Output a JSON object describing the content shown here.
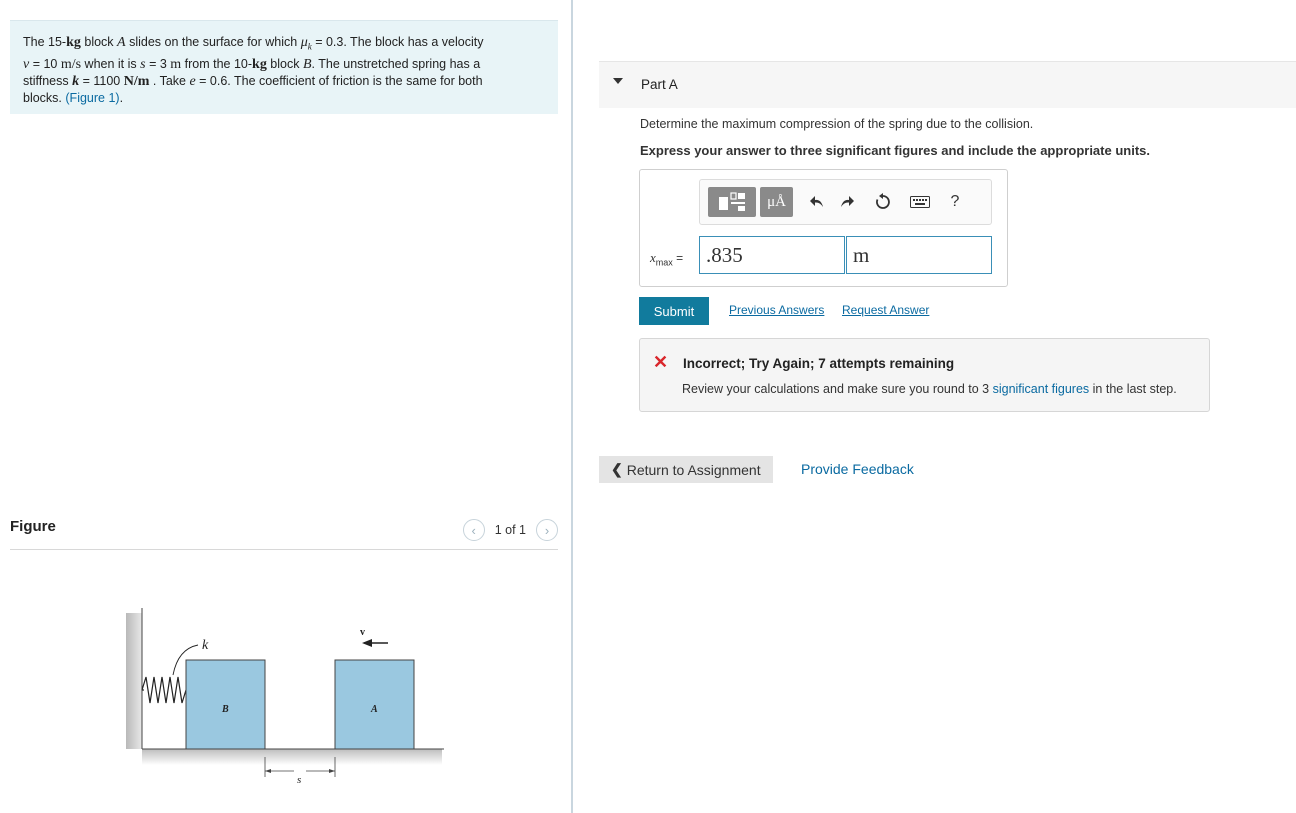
{
  "problem": {
    "line1_a": "The 15-",
    "kg": "kg",
    "line1_b": " block ",
    "A": "A",
    "line1_c": " slides on the surface for which ",
    "mu": "μ",
    "mu_sub": "k",
    "line1_d": " = 0.3. The block has a velocity",
    "v": "v",
    "line2_a": " = 10 ",
    "ms": "m/s",
    "line2_b": " when it is ",
    "s": "s",
    "line2_c": " = 3 ",
    "m": "m",
    "line2_d": " from the 10-",
    "kg2": "kg",
    "line2_e": " block ",
    "B": "B",
    "line2_f": ". The unstretched spring has a",
    "line3_a": "stiffness ",
    "k": "k",
    "line3_b": " = 1100 ",
    "nm": "N/m",
    "line3_c": " . Take ",
    "e": "e",
    "line3_d": " = 0.6. The coefficient of friction is the same for both",
    "line4_a": "blocks. ",
    "figure_link": "(Figure 1)",
    "line4_b": "."
  },
  "figure_panel": {
    "title": "Figure",
    "pager": "1 of 1",
    "prev": "‹",
    "next": "›",
    "labels": {
      "k": "k",
      "v": "v",
      "B": "B",
      "A": "A",
      "s": "s"
    }
  },
  "part": {
    "label": "Part A"
  },
  "question": "Determine the maximum compression of the spring due to the collision.",
  "instruction": "Express your answer to three significant figures and include the appropriate units.",
  "toolbar": {
    "units_btn": "μÅ",
    "help": "?"
  },
  "answer": {
    "var": "x",
    "var_sub": "max",
    "eq": " =",
    "value": ".835",
    "unit": "m"
  },
  "submit_label": "Submit",
  "previous_answers": "Previous Answers",
  "request_answer": "Request Answer",
  "feedback": {
    "icon": "✕",
    "title": "Incorrect; Try Again; 7 attempts remaining",
    "msg_a": "Review your calculations and make sure you round to 3 ",
    "msg_link": "significant figures",
    "msg_b": " in the last step."
  },
  "return_label": "Return to Assignment",
  "provide_feedback": "Provide Feedback",
  "colors": {
    "accent": "#117b9d",
    "link": "#0a6aa1",
    "error": "#d9262b",
    "block": "#9ac8e0"
  }
}
